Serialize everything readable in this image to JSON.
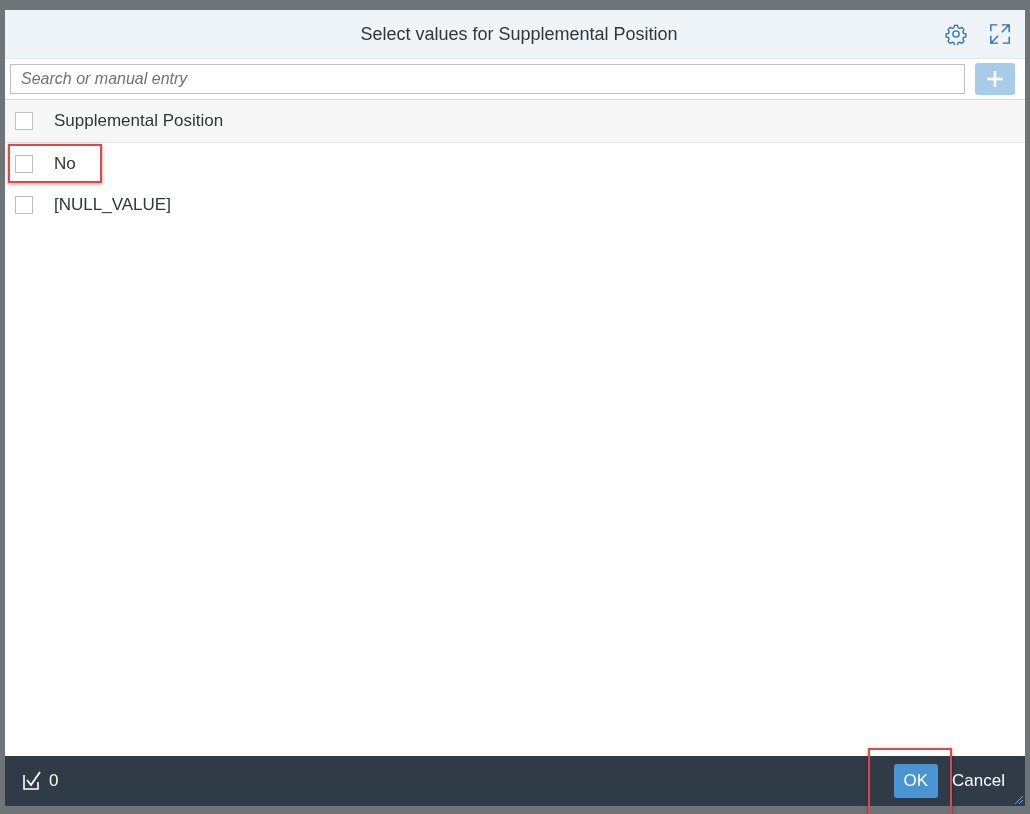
{
  "dialog": {
    "title": "Select values for Supplemental Position"
  },
  "search": {
    "placeholder": "Search or manual entry"
  },
  "table": {
    "header": {
      "label": "Supplemental Position",
      "checked": false
    },
    "rows": [
      {
        "label": "No",
        "checked": false,
        "highlighted": true
      },
      {
        "label": "[NULL_VALUE]",
        "checked": false,
        "highlighted": false
      }
    ]
  },
  "footer": {
    "selected_count": "0",
    "buttons": [
      {
        "label": "OK",
        "kind": "primary",
        "highlighted": true
      },
      {
        "label": "Cancel",
        "kind": "plain",
        "highlighted": false
      }
    ]
  }
}
